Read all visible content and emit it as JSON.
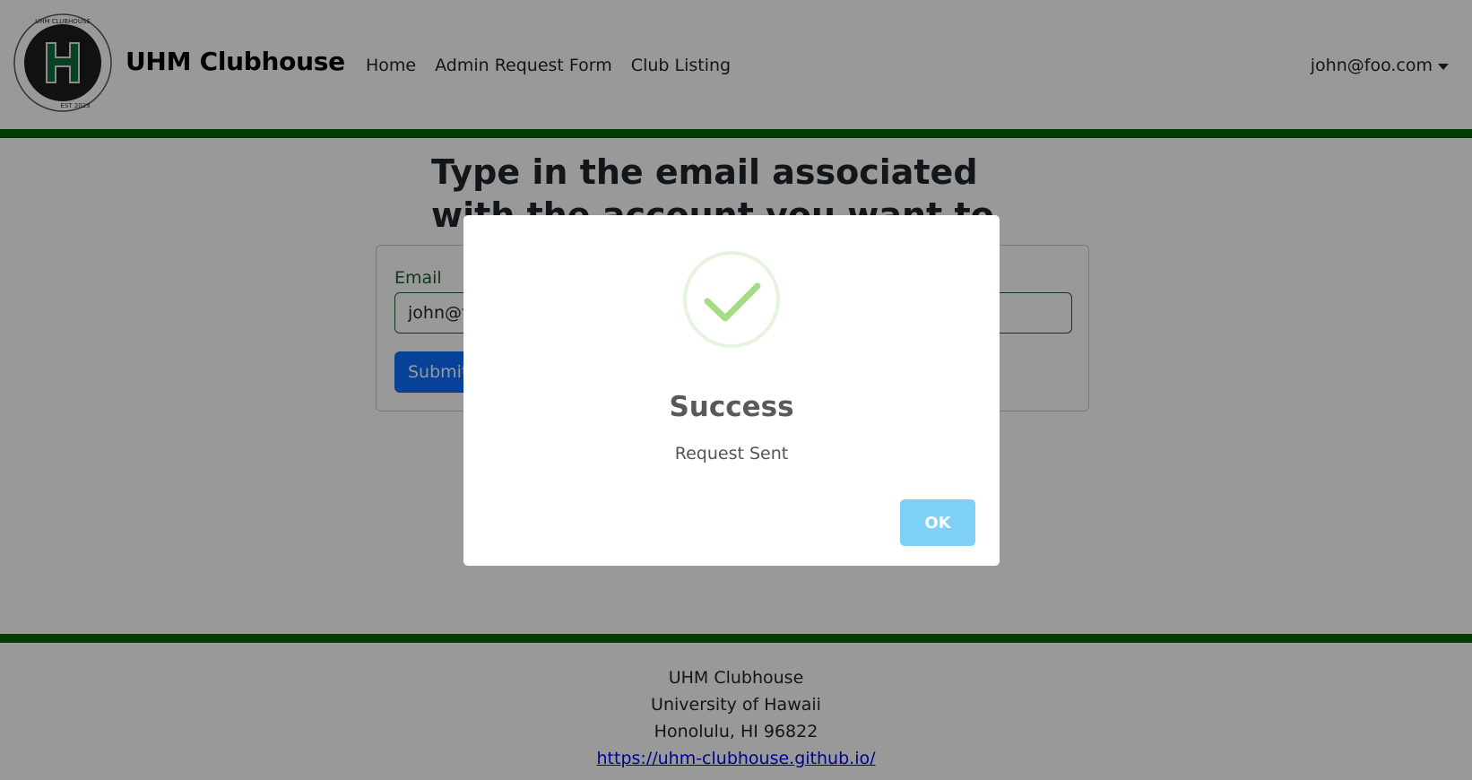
{
  "navbar": {
    "logo": {
      "ring_text": "UHM CLUBHOUSE",
      "est_text": "EST 2023"
    },
    "brand": "UHM Clubhouse",
    "links": [
      {
        "label": "Home"
      },
      {
        "label": "Admin Request Form"
      },
      {
        "label": "Club Listing"
      }
    ],
    "user": "john@foo.com",
    "accent_color": "#006400"
  },
  "main": {
    "title": "Type in the email associated with the account you want to make an admin.",
    "form": {
      "label": "Email",
      "value": "john@foo.com",
      "submit_label": "Submit"
    }
  },
  "footer": {
    "lines": [
      "UHM Clubhouse",
      "University of Hawaii",
      "Honolulu, HI 96822"
    ],
    "link": "https://uhm-clubhouse.github.io/"
  },
  "modal": {
    "icon": "success-check-icon",
    "title": "Success",
    "text": "Request Sent",
    "ok_label": "OK",
    "success_color": "#a5dc86",
    "ok_color": "#7fd0f6"
  }
}
